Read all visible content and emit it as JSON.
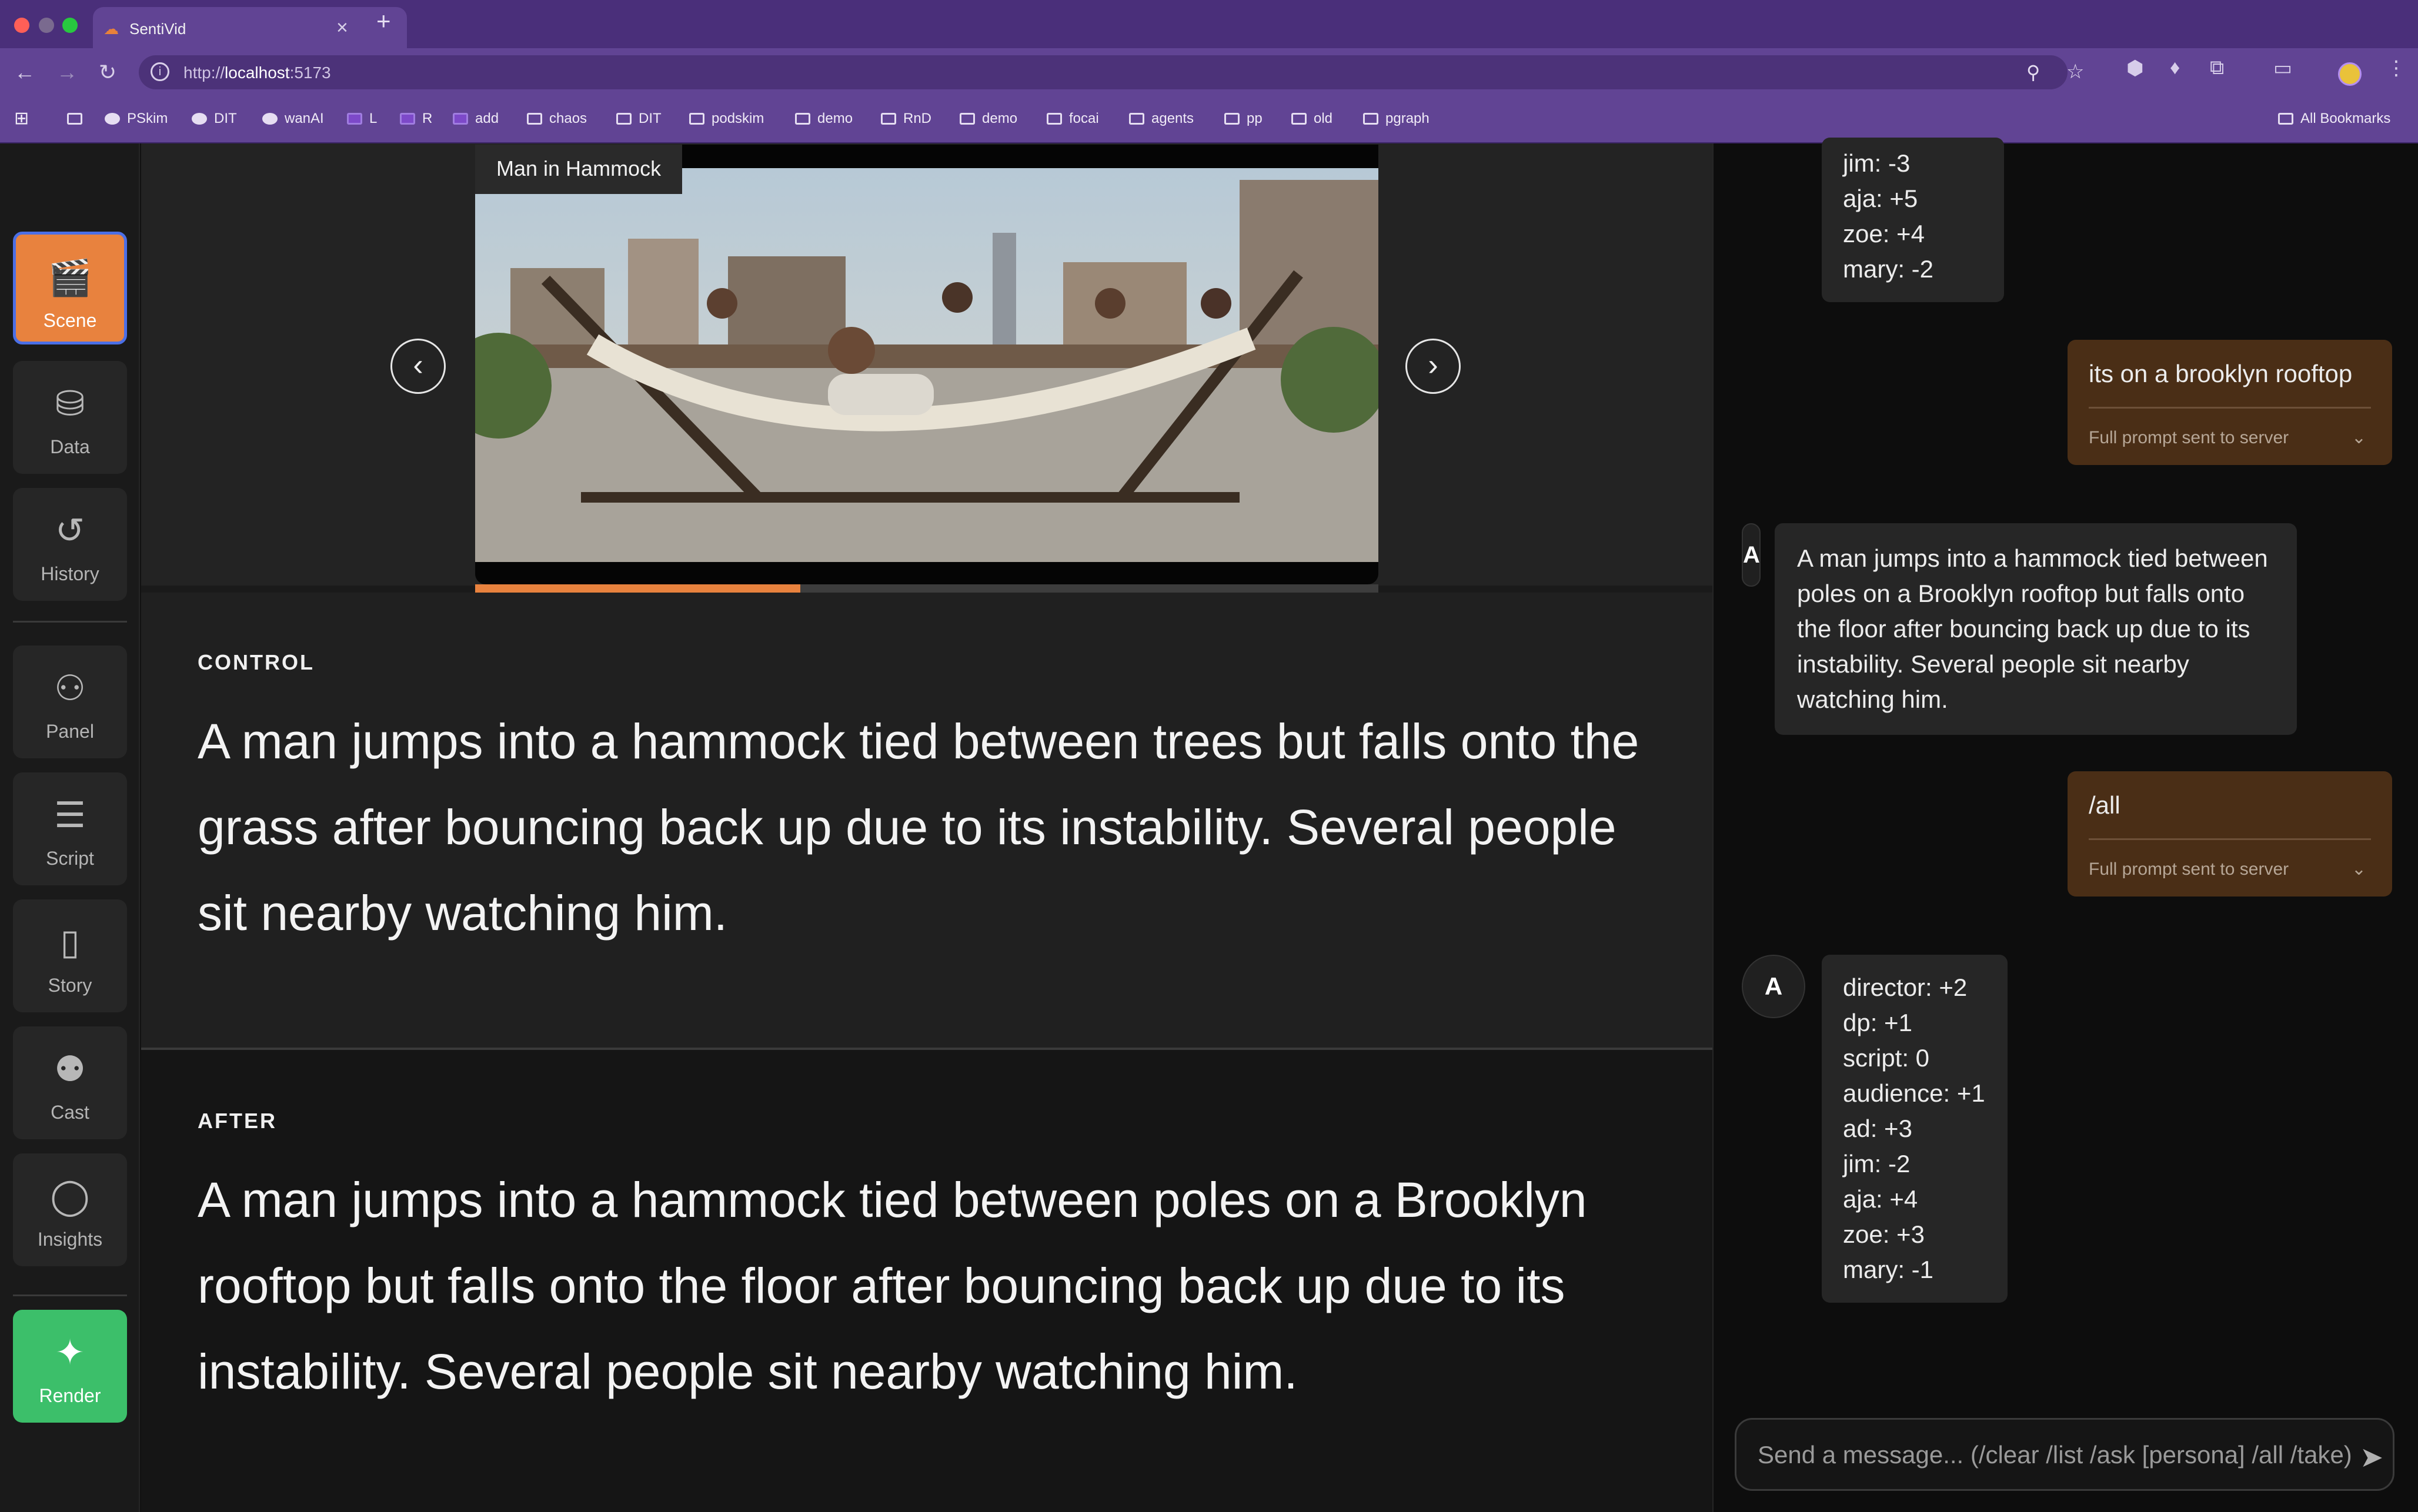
{
  "browser": {
    "tab_title": "SentiVid",
    "url_prefix": "http://",
    "url_host": "localhost",
    "url_port": ":5173",
    "bookmarks": [
      "PSkim",
      "DIT",
      "wanAI",
      "L",
      "R",
      "add",
      "chaos",
      "DIT",
      "podskim",
      "demo",
      "RnD",
      "demo",
      "focai",
      "agents",
      "pp",
      "old",
      "pgraph"
    ],
    "all_bookmarks": "All Bookmarks"
  },
  "sidebar": {
    "items": [
      {
        "label": "Scene",
        "icon": "clapperboard-icon"
      },
      {
        "label": "Data",
        "icon": "database-icon"
      },
      {
        "label": "History",
        "icon": "history-icon"
      },
      {
        "label": "Panel",
        "icon": "panel-people-icon"
      },
      {
        "label": "Script",
        "icon": "script-icon"
      },
      {
        "label": "Story",
        "icon": "book-icon"
      },
      {
        "label": "Cast",
        "icon": "cast-icon"
      },
      {
        "label": "Insights",
        "icon": "lightbulb-icon"
      }
    ],
    "render_label": "Render"
  },
  "video": {
    "title": "Man in Hammock",
    "progress": 0.36
  },
  "control": {
    "heading": "CONTROL",
    "text": "A man jumps into a hammock tied between trees but falls onto the grass after bouncing back up due to its instability. Several people sit nearby watching him."
  },
  "after": {
    "heading": "AFTER",
    "text": "A man jumps into a hammock tied between poles on a Brooklyn rooftop but falls onto the floor after bouncing back up due to its instability. Several people sit nearby watching him."
  },
  "chat": {
    "top_scores": [
      "jim: -3",
      "aja: +5",
      "zoe: +4",
      "mary: -2"
    ],
    "user_msg_1": "its on a brooklyn rooftop",
    "full_prompt_label": "Full prompt sent to server",
    "assistant_msg": "A man jumps into a hammock tied between poles on a Brooklyn rooftop but falls onto the floor after bouncing back up due to its instability. Several people sit nearby watching him.",
    "avatar_letter": "A",
    "user_msg_2": "/all",
    "scores": [
      "director: +2",
      "dp: +1",
      "script: 0",
      "audience: +1",
      "ad: +3",
      "jim: -2",
      "aja: +4",
      "zoe: +3",
      "mary: -1"
    ],
    "input_placeholder": "Send a message... (/clear /list /ask [persona] /all /take)"
  },
  "colors": {
    "accent": "#e8823e",
    "render": "#3cbf6a",
    "chrome": "#614494"
  }
}
